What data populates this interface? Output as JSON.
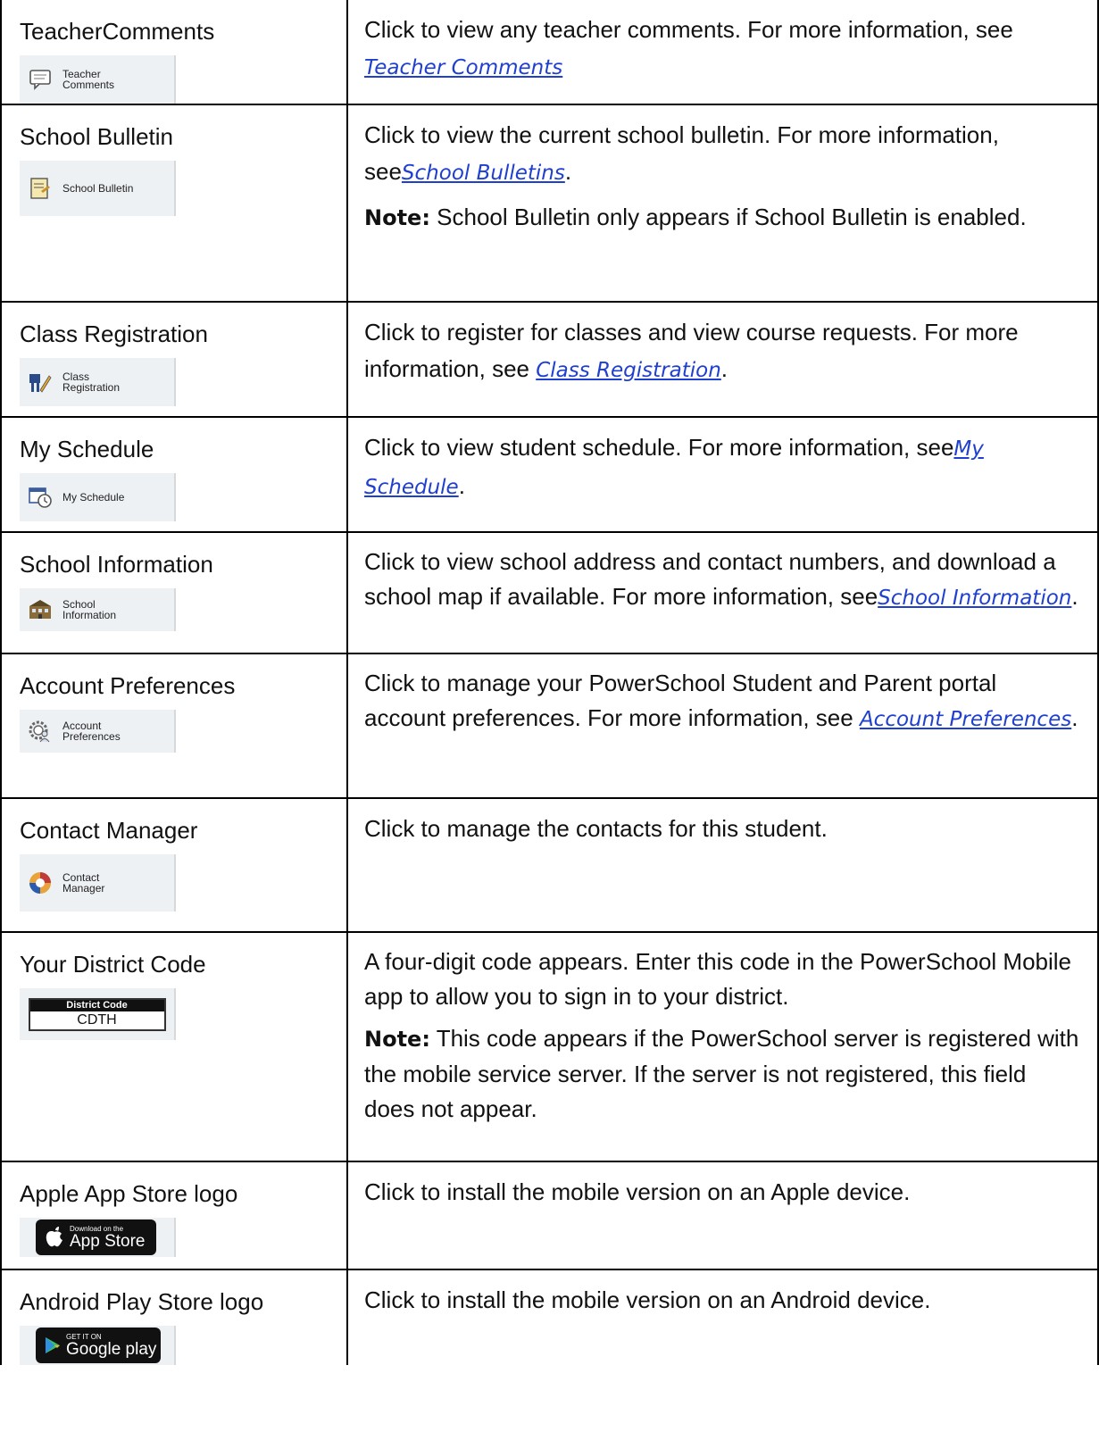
{
  "rows": [
    {
      "title": "TeacherComments",
      "thumb_label": "Teacher Comments",
      "icon": "comment-icon",
      "desc_pre": "Click to view any teacher comments. For more information, see",
      "link": "Teacher  Comments",
      "desc_post": ""
    },
    {
      "title": "School Bulletin",
      "thumb_label": "School Bulletin",
      "icon": "bulletin-icon",
      "desc_pre": "Click to view the current school bulletin. For more information, see",
      "link": "School Bulletins",
      "desc_post": ".",
      "note_label": "Note:",
      "note_text": "School Bulletin only appears if School Bulletin is enabled."
    },
    {
      "title": "Class Registration",
      "thumb_label": "Class Registration",
      "icon": "registration-icon",
      "desc_pre": "Click to register for classes and view course requests. For more information, see ",
      "link": "Class  Registration",
      "desc_post": "."
    },
    {
      "title": "My Schedule",
      "thumb_label": "My Schedule",
      "icon": "schedule-icon",
      "desc_pre": "Click to view student schedule. For more information, see",
      "link": "My  Schedule",
      "desc_post": "."
    },
    {
      "title": "School  Information",
      "thumb_label": "School Information",
      "icon": "school-building-icon",
      "desc_pre": "Click to view school address and contact numbers, and download a school map if available. For more information, see",
      "link": "School  Information",
      "desc_post": "."
    },
    {
      "title": "Account  Preferences",
      "thumb_label": "Account Preferences",
      "icon": "account-gear-icon",
      "desc_pre": "Click to manage your PowerSchool Student and Parent portal account preferences. For more information, see ",
      "link": "Account  Preferences",
      "desc_post": "."
    },
    {
      "title": "Contact Manager",
      "thumb_label": "Contact Manager",
      "icon": "contact-manager-icon",
      "desc_pre": "Click to manage the contacts for this student.",
      "link": "",
      "desc_post": ""
    },
    {
      "title": "Your District Code",
      "district_header": "District Code",
      "district_value": "CDTH",
      "desc_pre": "A four-digit code appears. Enter this code in the PowerSchool Mobile app to allow you to sign in to your district.",
      "link": "",
      "desc_post": "",
      "note_label": "Note:",
      "note_text": "This code appears if the PowerSchool server is registered with the mobile service server. If the server is not registered, this field does not appear."
    },
    {
      "title": "Apple App Store logo",
      "store_small": "Download on the",
      "store_big": "App Store",
      "icon": "apple-icon",
      "desc_pre": "Click to install the mobile version on an Apple device.",
      "link": "",
      "desc_post": ""
    },
    {
      "title": "Android Play Store logo",
      "store_small": "GET IT ON",
      "store_big": "Google play",
      "icon": "play-icon",
      "desc_pre": "Click to install the mobile version on an Android device.",
      "link": "",
      "desc_post": ""
    }
  ]
}
